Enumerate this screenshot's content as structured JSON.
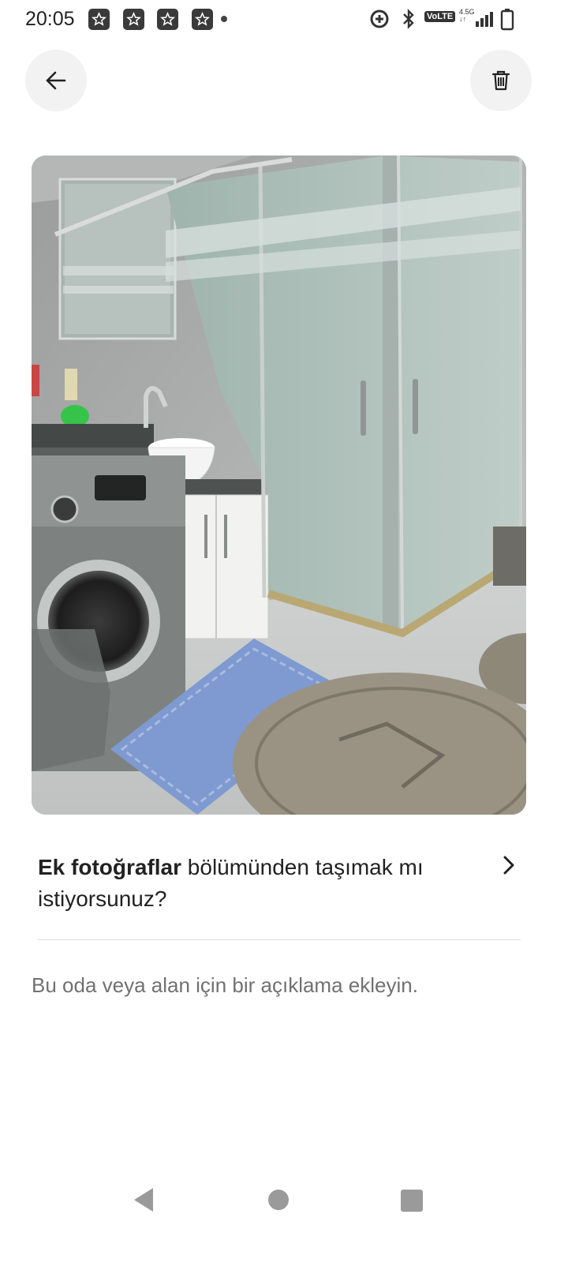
{
  "status_bar": {
    "time": "20:05",
    "network_label": "VoLTE",
    "network_type_top": "4.5G",
    "network_type_bottom": "↓↑",
    "icons": [
      "star-notification-icon",
      "star-notification-icon",
      "star-notification-icon",
      "star-notification-icon",
      "data-saver-icon",
      "bluetooth-icon",
      "signal-icon",
      "battery-icon"
    ]
  },
  "header": {
    "back_icon": "arrow-left-icon",
    "delete_icon": "trash-icon"
  },
  "photo": {
    "subject": "bathroom-photo"
  },
  "move_prompt": {
    "bold_part": "Ek fotoğraflar",
    "rest": " bölümünden taşımak mı istiyorsunuz?",
    "chevron_icon": "chevron-right-icon"
  },
  "description": {
    "placeholder": "Bu oda veya alan için bir açıklama ekleyin."
  },
  "nav_bar": {
    "icons": [
      "back-triangle-icon",
      "home-circle-icon",
      "recents-square-icon"
    ]
  },
  "colors": {
    "text_primary": "#222222",
    "text_secondary": "#717171",
    "button_bg": "#f2f2f2",
    "divider": "#dddddd"
  }
}
